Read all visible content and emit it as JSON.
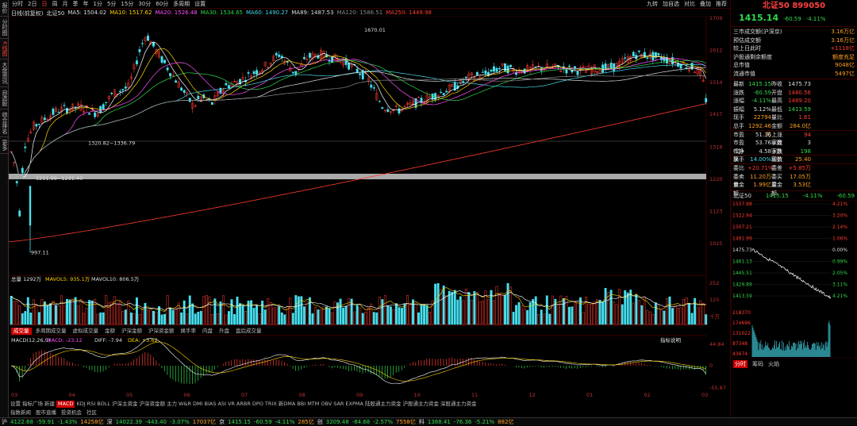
{
  "left_tabs": [
    "报价",
    "分时图",
    "K线图",
    "大盘资讯",
    "自选股",
    "综合排名",
    "更多"
  ],
  "toolbar": {
    "items": [
      "分时",
      "2日",
      "日",
      "周",
      "月",
      "季",
      "年",
      "1分",
      "5分",
      "15分",
      "30分",
      "60分",
      "多周期",
      "设置"
    ],
    "active": "日",
    "right": [
      "九转",
      "加自选",
      "对比",
      "叠加",
      "推荐"
    ]
  },
  "ma_legend": {
    "period": "日线(前复权)",
    "name": "北证50",
    "ma5": "MA5: 1504.02",
    "ma10": "MA10: 1517.62",
    "ma20": "MA20: 1526.48",
    "ma30": "MA30: 1534.65",
    "ma60": "MA60: 1490.27",
    "ma89": "MA89: 1487.53",
    "ma120": "MA120: 1586.51",
    "ma250": "MA250: 1449.98"
  },
  "price_axis": [
    "1709",
    "1612",
    "1514",
    "1417",
    "1318",
    "1220",
    "1123",
    "1025"
  ],
  "annotations": {
    "high": "1670.01",
    "low": "997.11",
    "range1": "1320.82~1336.79",
    "range2": "1211.99~1231.40"
  },
  "volume": {
    "label": "总量",
    "total": "1292万",
    "mavol5": "MAVOL5: 935.1万",
    "mavol10": "MAVOL10: 806.5万",
    "axis": [
      "252",
      "125",
      "十万"
    ]
  },
  "vol_tabs": [
    "成交量",
    "多周期成交量",
    "虚拟成交量",
    "金额",
    "沪深金额",
    "沪深资金额",
    "换手率",
    "内盘",
    "外盘",
    "盘后成交量"
  ],
  "macd": {
    "label": "MACD(12,26,9)",
    "macd": "MACD: -23.12",
    "diff": "DIFF: -7.94",
    "dea": "DEA: +3.62",
    "button": "指标说明",
    "axis": [
      "44.84",
      "0",
      "-55.87"
    ]
  },
  "date_axis": [
    "03",
    "04",
    "05",
    "06",
    "07",
    "08",
    "09",
    "10",
    "11",
    "12",
    "01",
    "02",
    "03"
  ],
  "indicator_tabs": [
    "设置",
    "指标广场",
    "新建",
    "MACD",
    "KDJ",
    "RSI",
    "BOLL",
    "沪深主资金",
    "沪深资金额",
    "主力",
    "W&R",
    "DMI",
    "BIAS",
    "ASI",
    "VR",
    "ARBR",
    "DPO",
    "TRIX",
    "新DMA",
    "BBI",
    "MTM",
    "OBV",
    "SAR",
    "EXPMA",
    "陆股通主力资金",
    "沪股通主力资金",
    "深股通主力资金"
  ],
  "indicator_active": "MACD",
  "sub_tabs": [
    "指数新闻",
    "股市直播",
    "投资机会",
    "社区"
  ],
  "right_panel": {
    "title": "北证50 899050",
    "price": "1415.14",
    "change": "-60.59",
    "pct": "-4.11%",
    "stats": [
      {
        "l": "三市成交额(沪深京)",
        "v": "3.16万亿",
        "c": "org"
      },
      {
        "l": "预估成交额",
        "v": "3.16万亿",
        "c": "org"
      },
      {
        "l": "较上日此时",
        "v": "+1118亿",
        "c": "red"
      },
      {
        "l": "沪股通剩余额度",
        "v": "额度充足",
        "c": "org"
      },
      {
        "l": "总市值",
        "v": "9048亿",
        "c": "org"
      },
      {
        "l": "流通市值",
        "v": "5497亿",
        "c": "org"
      }
    ],
    "quote": [
      [
        "最新",
        "1415.15",
        "昨收",
        "1475.73",
        "grn",
        "wht"
      ],
      [
        "涨跌",
        "-60.59",
        "开盘",
        "1480.56",
        "grn",
        "red"
      ],
      [
        "涨幅",
        "-4.11%",
        "最高",
        "1489.20",
        "grn",
        "red"
      ],
      [
        "振幅",
        "5.12%",
        "最低",
        "1413.59",
        "wht",
        "grn"
      ],
      [
        "现手",
        "22794",
        "量比",
        "1.61",
        "org",
        "red"
      ],
      [
        "总手",
        "1292.46万",
        "金额",
        "284.0亿",
        "org",
        "org"
      ],
      [
        "市盈",
        "51.36",
        "上涨家数",
        "94",
        "wht",
        "red"
      ],
      [
        "市盈(动)",
        "53.76",
        "平盘家数",
        "3",
        "wht",
        "wht"
      ],
      [
        "市净率",
        "4.58",
        "下跌家数",
        "198",
        "wht",
        "grn"
      ],
      [
        "换手",
        "14.00%",
        "均价",
        "25.40",
        "cy",
        "org"
      ],
      [
        "委比",
        "+20.71%",
        "委差",
        "+5.85万",
        "red",
        "red"
      ],
      [
        "委卖量",
        "11.20万",
        "委买量",
        "17.05万",
        "org",
        "org"
      ],
      [
        "卖金额",
        "1.99亿",
        "买金额",
        "3.53亿",
        "org",
        "org"
      ]
    ],
    "mini": {
      "name": "北证50",
      "price": "1415.15",
      "pct": "-4.11%",
      "chg": "-60.59"
    },
    "mini_left_axis": [
      "1537.88",
      "1522.94",
      "1507.21",
      "1491.99",
      "1475.73",
      "1461.13",
      "1445.51",
      "1429.89",
      "1413.59"
    ],
    "mini_right_axis": [
      "4.21%",
      "3.20%",
      "2.14%",
      "1.06%",
      "0.00%",
      "0.99%",
      "2.05%",
      "3.11%",
      "4.21%"
    ],
    "mini_vol_axis": [
      "218370",
      "174696",
      "131022",
      "87348",
      "43674"
    ],
    "tabs": [
      "分时",
      "筹码",
      "火焰"
    ]
  },
  "bottom_bar": [
    {
      "t": "沪",
      "c": "wht"
    },
    {
      "t": "4122.68",
      "c": "grn"
    },
    {
      "t": "-59.91",
      "c": "grn"
    },
    {
      "t": "-1.43%",
      "c": "grn"
    },
    {
      "t": "14258亿",
      "c": "org"
    },
    {
      "t": "深",
      "c": "wht"
    },
    {
      "t": "14022.39",
      "c": "grn"
    },
    {
      "t": "-443.40",
      "c": "grn"
    },
    {
      "t": "-3.07%",
      "c": "grn"
    },
    {
      "t": "17037亿",
      "c": "org"
    },
    {
      "t": "京",
      "c": "wht"
    },
    {
      "t": "1415.15",
      "c": "grn"
    },
    {
      "t": "-60.59",
      "c": "grn"
    },
    {
      "t": "-4.11%",
      "c": "grn"
    },
    {
      "t": "285亿",
      "c": "org"
    },
    {
      "t": "创",
      "c": "wht"
    },
    {
      "t": "3209.48",
      "c": "grn"
    },
    {
      "t": "-84.68",
      "c": "grn"
    },
    {
      "t": "-2.57%",
      "c": "grn"
    },
    {
      "t": "7558亿",
      "c": "org"
    },
    {
      "t": "科",
      "c": "wht"
    },
    {
      "t": "1388.41",
      "c": "grn"
    },
    {
      "t": "-76.36",
      "c": "grn"
    },
    {
      "t": "-5.21%",
      "c": "grn"
    },
    {
      "t": "882亿",
      "c": "org"
    }
  ]
}
